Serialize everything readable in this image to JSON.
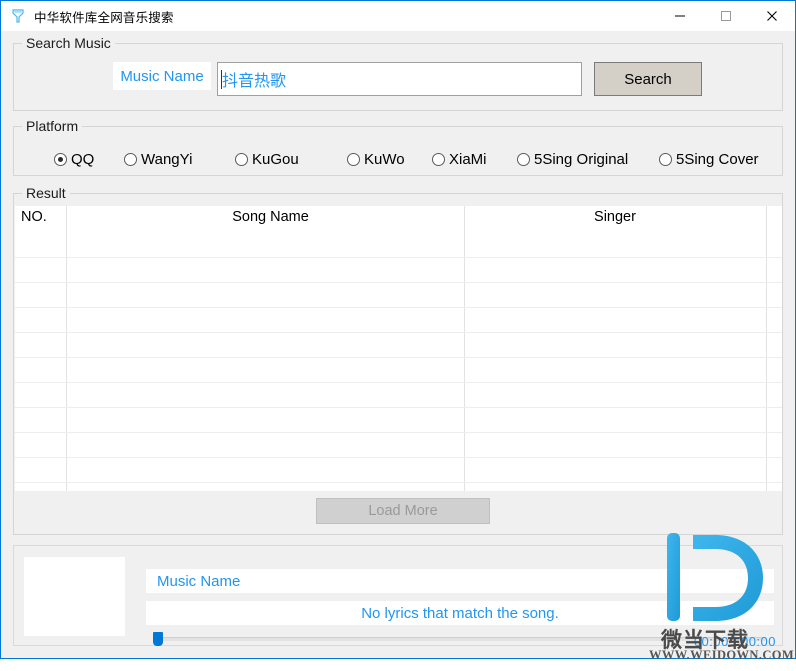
{
  "window": {
    "title": "中华软件库全网音乐搜索",
    "icon": "app-logo-icon",
    "minimize_label": "—",
    "maximize_label": "□",
    "close_label": "✕"
  },
  "search_group": {
    "legend": "Search Music",
    "music_name_label": "Music Name",
    "input_value": "抖音热歌",
    "input_placeholder": "",
    "search_button": "Search"
  },
  "platform_group": {
    "legend": "Platform",
    "options": [
      {
        "label": "QQ",
        "selected": true
      },
      {
        "label": "WangYi",
        "selected": false
      },
      {
        "label": "KuGou",
        "selected": false
      },
      {
        "label": "KuWo",
        "selected": false
      },
      {
        "label": "XiaMi",
        "selected": false
      },
      {
        "label": "5Sing Original",
        "selected": false
      },
      {
        "label": "5Sing Cover",
        "selected": false
      }
    ]
  },
  "result_group": {
    "legend": "Result",
    "columns": [
      "NO.",
      "Song Name",
      "Singer",
      ""
    ],
    "rows": [],
    "empty_row_count": 11,
    "load_more_button": "Load More"
  },
  "player": {
    "album_art": "album-art-placeholder",
    "music_name": "Music Name",
    "lyrics": "No lyrics that match the song.",
    "elapsed_time": "00:00",
    "total_time": "00:00",
    "time_display": "00:00 | 00:00",
    "seek_position_percent": 0
  },
  "watermark": {
    "logo_letter": "D",
    "chinese": "微当下载",
    "url": "WWW.WEIDOWN.COM"
  },
  "colors": {
    "accent_blue": "#2196f3",
    "window_border": "#0078d7",
    "panel_bg": "#f0f0f0",
    "slider_blue": "#0078d7"
  }
}
